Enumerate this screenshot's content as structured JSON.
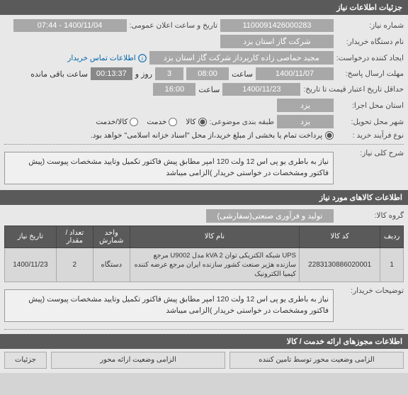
{
  "header": {
    "title": "جزئیات اطلاعات نیاز"
  },
  "form": {
    "need_number_label": "شماره نیاز:",
    "need_number": "1100091426000283",
    "public_date_label": "تاریخ و ساعت اعلان عمومی:",
    "public_date": "1400/11/04 - 07:44",
    "buyer_name_label": "نام دستگاه خریدار:",
    "buyer_name": "شرکت گاز استان یزد",
    "creator_label": "ایجاد کننده درخواست:",
    "creator": "مجید حماصی زاده کارپرداز شرکت گاز استان یزد",
    "contact_link": "اطلاعات تماس خریدار",
    "send_deadline_label": "مهلت ارسال پاسخ:",
    "send_date": "1400/11/07",
    "time_label": "ساعت",
    "send_time": "08:00",
    "days_label": "روز و",
    "days": "3",
    "countdown": "00:13:37",
    "countdown_label": "ساعت باقی مانده",
    "credit_expire_label": "حداقل تاریخ اعتبار قیمت تا تاریخ:",
    "credit_date": "1400/11/23",
    "credit_time": "16:00",
    "exec_province_label": "استان محل اجرا:",
    "exec_province": "یزد",
    "delivery_city_label": "شهر محل تحویل:",
    "delivery_city": "یزد",
    "category_label": "طبقه بندی موضوعی:",
    "cat_goods": "کالا",
    "cat_service": "خدمت",
    "cat_both": "کالا/خدمت",
    "contract_type_label": "نوع فرآیند خرید :",
    "contract_text": "پرداخت تمام یا بخشی از مبلغ خرید،از محل \"اسناد خزانه اسلامی\" خواهد بود.",
    "summary_label": "شرح کلی نیاز:",
    "summary": "نیاز به باطری یو پی اس 12 ولت 120 امپر مطابق پیش فاکتور تکمیل وتایید مشخصات پیوست (پیش فاکتور ومشخصات در خواستی خریدار )الزامی میباشد",
    "goods_header": "اطلاعات کالاهای مورد نیاز",
    "goods_group_label": "گروه کالا:",
    "goods_group": "تولید و فرآوری صنعتی(سفارشی)",
    "buyer_notes_label": "توضیحات خریدار:",
    "buyer_notes": "نیاز به باطری یو پی اس 12 ولت 120 امپر مطابق پیش فاکتور تکمیل وتایید مشخصات پیوست (پیش فاکتور ومشخصات در خواستی خریدار )الزامی میباشد"
  },
  "table": {
    "headers": {
      "row": "ردیف",
      "code": "کد کالا",
      "name": "نام کالا",
      "unit": "واحد شمارش",
      "qty": "تعداد / مقدار",
      "date": "تاریخ نیاز"
    },
    "rows": [
      {
        "idx": "1",
        "code": "2283130886020001",
        "name": "UPS شبکه الکتریکی توان kVA 2 مدل U9002 مرجع سازنده هژیر صنعت کشور سازنده ایران مرجع عرضه کننده کیمیا الکترونیک",
        "unit": "دستگاه",
        "qty": "2",
        "date": "1400/11/23"
      }
    ]
  },
  "bottom": {
    "permits_header": "اطلاعات مجوزهای ارائه خدمت / کالا",
    "auth_box1": "الزامی وضعیت محور توسط تامین کننده",
    "auth_box2": "الزامی وضعیت ارائه محور",
    "details": "جزئیات"
  }
}
